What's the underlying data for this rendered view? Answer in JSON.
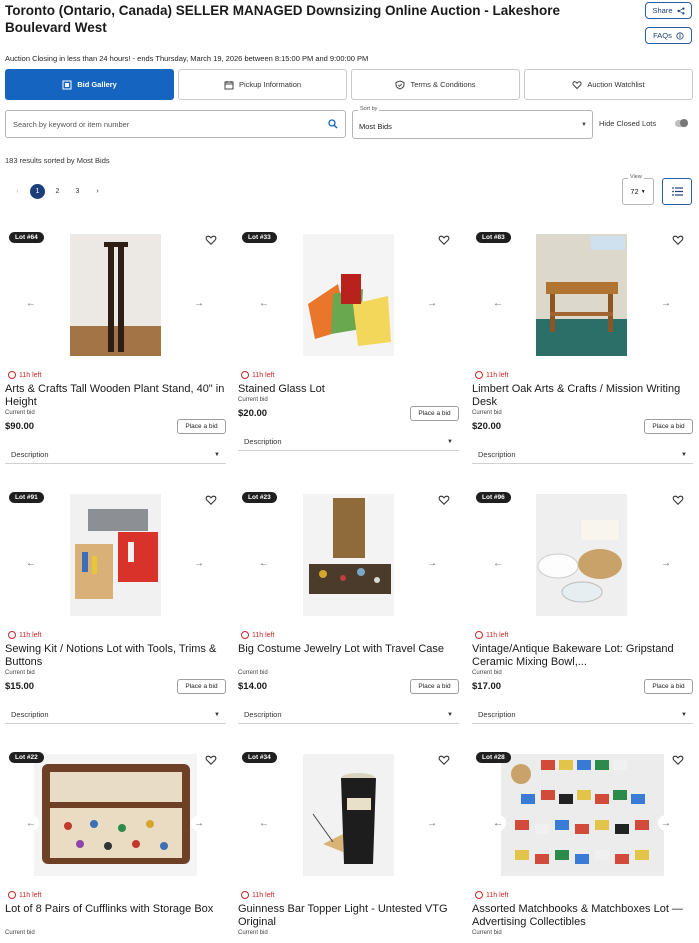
{
  "header": {
    "title": "Toronto (Ontario, Canada) SELLER MANAGED Downsizing Online Auction - Lakeshore Boulevard West",
    "share_label": "Share",
    "faq_label": "FAQs",
    "closing_text": "Auction Closing in less than 24 hours! - ends Thursday, March 19, 2026 between 8:15:00 PM and 9:00:00 PM"
  },
  "tabs": [
    {
      "label": "Bid Gallery",
      "icon": "gallery-icon"
    },
    {
      "label": "Pickup Information",
      "icon": "calendar-icon"
    },
    {
      "label": "Terms & Conditions",
      "icon": "shield-icon"
    },
    {
      "label": "Auction Watchlist",
      "icon": "heart-icon"
    }
  ],
  "filters": {
    "search_placeholder": "Search by keyword or item number",
    "sort_label": "Sort by",
    "sort_value": "Most Bids",
    "hide_closed_label": "Hide Closed Lots"
  },
  "results_text": "183 results sorted by Most Bids",
  "pager": {
    "prev": "‹",
    "pages": [
      "1",
      "2",
      "3"
    ],
    "next": "›"
  },
  "view": {
    "label": "View",
    "value": "72"
  },
  "common": {
    "current_bid": "Current bid",
    "place_bid": "Place a bid",
    "description": "Description"
  },
  "lots": [
    {
      "lot": "Lot #64",
      "time": "11h left",
      "title": "Arts & Crafts Tall Wooden Plant Stand, 40\" in Height",
      "price": "$90.00"
    },
    {
      "lot": "Lot #33",
      "time": "11h left",
      "title": "Stained Glass Lot",
      "price": "$20.00"
    },
    {
      "lot": "Lot #83",
      "time": "11h left",
      "title": "Limbert Oak Arts & Crafts / Mission Writing Desk",
      "price": "$20.00"
    },
    {
      "lot": "Lot #91",
      "time": "11h left",
      "title": "Sewing Kit / Notions Lot with Tools, Trims & Buttons",
      "price": "$15.00"
    },
    {
      "lot": "Lot #23",
      "time": "11h left",
      "title": "Big Costume Jewelry Lot with Travel Case",
      "price": "$14.00"
    },
    {
      "lot": "Lot #96",
      "time": "11h left",
      "title": "Vintage/Antique Bakeware Lot: Gripstand Ceramic Mixing Bowl,...",
      "price": "$17.00"
    },
    {
      "lot": "Lot #22",
      "time": "11h left",
      "title": "Lot of 8 Pairs of Cufflinks with Storage Box",
      "price": ""
    },
    {
      "lot": "Lot #34",
      "time": "11h left",
      "title": "Guinness Bar Topper Light - Untested VTG Original",
      "price": ""
    },
    {
      "lot": "Lot #28",
      "time": "11h left",
      "title": "Assorted Matchbooks & Matchboxes Lot — Advertising Collectibles",
      "price": ""
    }
  ],
  "colors": {
    "primary": "#1565c0",
    "time_red": "#c62828",
    "badge": "#1f1f1f"
  }
}
